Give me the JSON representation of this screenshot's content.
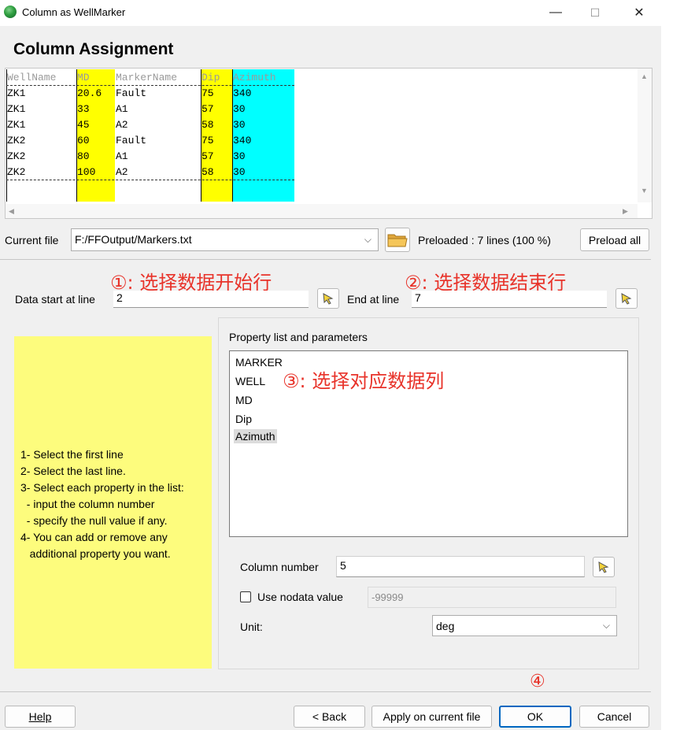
{
  "window": {
    "title": "Column as WellMarker",
    "minimize": "—",
    "maximize": "☐",
    "close": "✕"
  },
  "heading": "Column Assignment",
  "preview": {
    "columns": [
      {
        "header": "WellName",
        "values": [
          "ZK1",
          "ZK1",
          "ZK1",
          "ZK2",
          "ZK2",
          "ZK2"
        ],
        "color": "#ffffff"
      },
      {
        "header": "MD",
        "values": [
          "20.6",
          "33",
          "45",
          "60",
          "80",
          "100"
        ],
        "color": "#ffff00"
      },
      {
        "header": "MarkerName",
        "values": [
          "Fault",
          "A1",
          "A2",
          "Fault",
          "A1",
          "A2"
        ],
        "color": "#ffffff"
      },
      {
        "header": "Dip",
        "values": [
          "75",
          "57",
          "58",
          "75",
          "57",
          "58"
        ],
        "color": "#ffff00"
      },
      {
        "header": "Azimuth",
        "values": [
          "340",
          "30",
          "30",
          "340",
          "30",
          "30"
        ],
        "color": "#00ffff"
      }
    ]
  },
  "file_row": {
    "label": "Current file",
    "value": "F:/FFOutput/Markers.txt",
    "status": "Preloaded : 7 lines (100 %)",
    "preload_all": "Preload all"
  },
  "annotations": {
    "a1": "①: 选择数据开始行",
    "a2": "②: 选择数据结束行",
    "a3": "③: 选择对应数据列",
    "a4": "④"
  },
  "lines": {
    "start_label": "Data start at line",
    "start_value": "2",
    "end_label": "End at line",
    "end_value": "7"
  },
  "help_text": "1- Select the first line\n2- Select the last line.\n3- Select each property in the list:\n  - input the column number\n  - specify the null value if any.\n4- You can add or remove any\n   additional property you want.",
  "properties": {
    "title": "Property list and parameters",
    "items": [
      "MARKER",
      "WELL",
      "MD",
      "Dip",
      "Azimuth"
    ],
    "selected": "Azimuth",
    "column_label": "Column number",
    "column_value": "5",
    "nodata_label": "Use nodata value",
    "nodata_value": "-99999",
    "unit_label": "Unit:",
    "unit_value": "deg"
  },
  "buttons": {
    "help": "Help",
    "back": "< Back",
    "apply": "Apply on current file",
    "ok": "OK",
    "cancel": "Cancel"
  }
}
